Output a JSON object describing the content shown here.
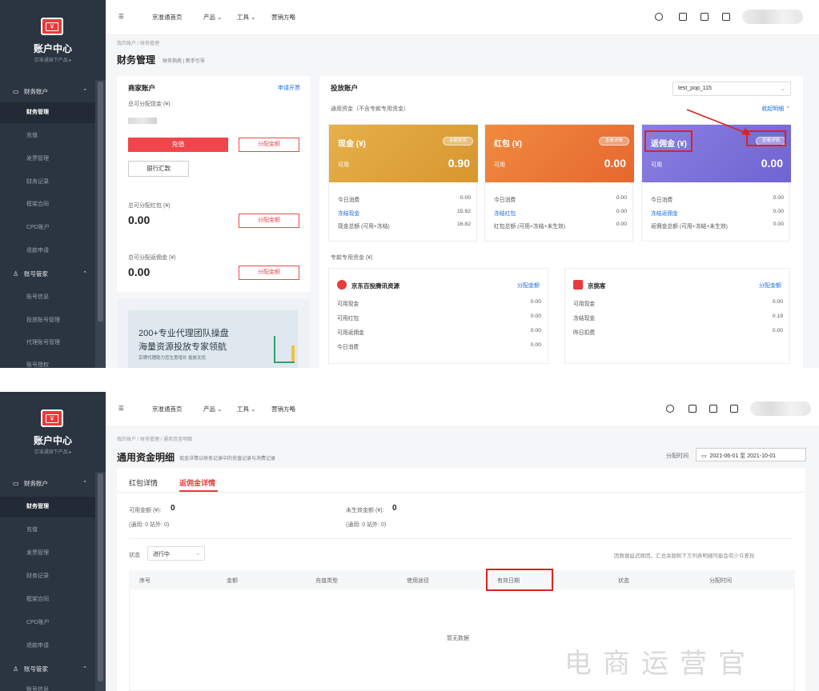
{
  "sidebar": {
    "title": "账户中心",
    "subtitle": "京准通旗下产品 ▸",
    "group_finance": "财务账户",
    "items_s1": [
      "财务管理",
      "充值",
      "发票管理",
      "财务记录",
      "框架合同",
      "CPD账户",
      "退款申请"
    ],
    "group_account": "账号管家",
    "items_acct_s1": [
      "账号信息",
      "投放账号管理",
      "代理账号管理",
      "账号授权"
    ],
    "items_s2": [
      "财务管理",
      "充值",
      "发票管理",
      "财务记录",
      "框架合同",
      "CPD账户",
      "退款申请"
    ],
    "items_acct_s2": [
      "账号信息"
    ]
  },
  "topnav": {
    "home": "京准通首页",
    "product": "产品 ⌄",
    "tools": "工具 ⌄",
    "strategy": "营销方略"
  },
  "s1": {
    "breadcrumb": "我的账户 / 财务管理",
    "title": "财务管理",
    "title_sub": "财务指南 | 新手引导",
    "merchant": {
      "header": "商家账户",
      "apply_link": "申请开票",
      "total_cash_label": "总可分配现金 (¥)",
      "recharge": "充值",
      "allocate": "分配金额",
      "bank_transfer": "银行汇款",
      "redpacket_label": "总可分配红包 (¥)",
      "redpacket_value": "0.00",
      "allocate2": "分配金额",
      "rebate_label": "总可分配返佣金 (¥)",
      "rebate_value": "0.00",
      "allocate3": "分配金额"
    },
    "banner": {
      "line1": "200+专业代理团队操盘",
      "line2": "海量资源投放专家领航",
      "line3": "京牌代理助力您生意增长 投放无忧"
    },
    "ad": {
      "header": "投放账户",
      "account_select": "test_pop_115",
      "general_funds": "通用资金（不含专款专用资金）",
      "collapse": "收起明细 ⌃",
      "cards": [
        {
          "title": "现金 (¥)",
          "pill": "余额提现",
          "avail": "可用",
          "value": "0.90",
          "rows": [
            [
              "今日消费",
              "0.00"
            ],
            [
              "冻结现金",
              "15.92"
            ],
            [
              "现金总额 (可用+冻结)",
              "16.82"
            ]
          ],
          "color": "#e0a53c"
        },
        {
          "title": "红包 (¥)",
          "pill": "查看详情",
          "avail": "可用",
          "value": "0.00",
          "rows": [
            [
              "今日消费",
              "0.00"
            ],
            [
              "冻结红包",
              "0.00"
            ],
            [
              "红包总额 (可用+冻结+未生效)",
              "0.00"
            ]
          ],
          "color": "#ee7a3a"
        },
        {
          "title": "返佣金 (¥)",
          "pill": "查看详情",
          "avail": "可用",
          "value": "0.00",
          "rows": [
            [
              "今日消费",
              "0.00"
            ],
            [
              "冻结返佣金",
              "0.00"
            ],
            [
              "返佣金总额 (可用+冻结+未生效)",
              "0.00"
            ]
          ],
          "color": "#7a70d9"
        }
      ],
      "special_label": "专款专用资金 (¥)",
      "jd": {
        "name": "京东百投腾讯资源",
        "alloc": "分配金额",
        "rows": [
          [
            "可用现金",
            "0.00"
          ],
          [
            "可用红包",
            "0.00"
          ],
          [
            "可用返佣金",
            "0.00"
          ],
          [
            "今日消费",
            "0.00"
          ]
        ]
      },
      "jt": {
        "name": "京挑客",
        "alloc": "分配金额",
        "rows": [
          [
            "可用现金",
            "0.00"
          ],
          [
            "冻结现金",
            "0.19"
          ],
          [
            "昨日扣费",
            "0.00"
          ]
        ]
      }
    }
  },
  "s2": {
    "breadcrumb": "我的账户 / 财务管理 / 通用资金明细",
    "title": "通用资金明细",
    "title_sub": "现金详情以财务记录中的充值记录与消费记录",
    "date_label": "分配时间",
    "date_from": "2021-06-01",
    "date_sep": "至",
    "date_to": "2021-10-01",
    "tabs": [
      "红包详情",
      "返佣金详情"
    ],
    "avail_label": "可用金额 (¥):",
    "avail_value": "0",
    "avail_sub": "(通用: 0  站外: 0)",
    "pending_label": "未生效金额 (¥):",
    "pending_value": "0",
    "pending_sub": "(通用: 0  站外: 0)",
    "status_label": "状态",
    "status_value": "进行中",
    "notice": "因数据延迟原因，汇总余额和下方列表明细可能会有少许差异",
    "columns": [
      "序号",
      "金额",
      "充值类型",
      "使用途径",
      "有效日期",
      "状态",
      "分配时间"
    ],
    "empty": "暂无数据"
  },
  "watermark": "电商运营官",
  "colors": {
    "accent": "#f0454a",
    "sidebar": "#2b3441",
    "link": "#1a6fe0",
    "highlight": "#e02020"
  }
}
